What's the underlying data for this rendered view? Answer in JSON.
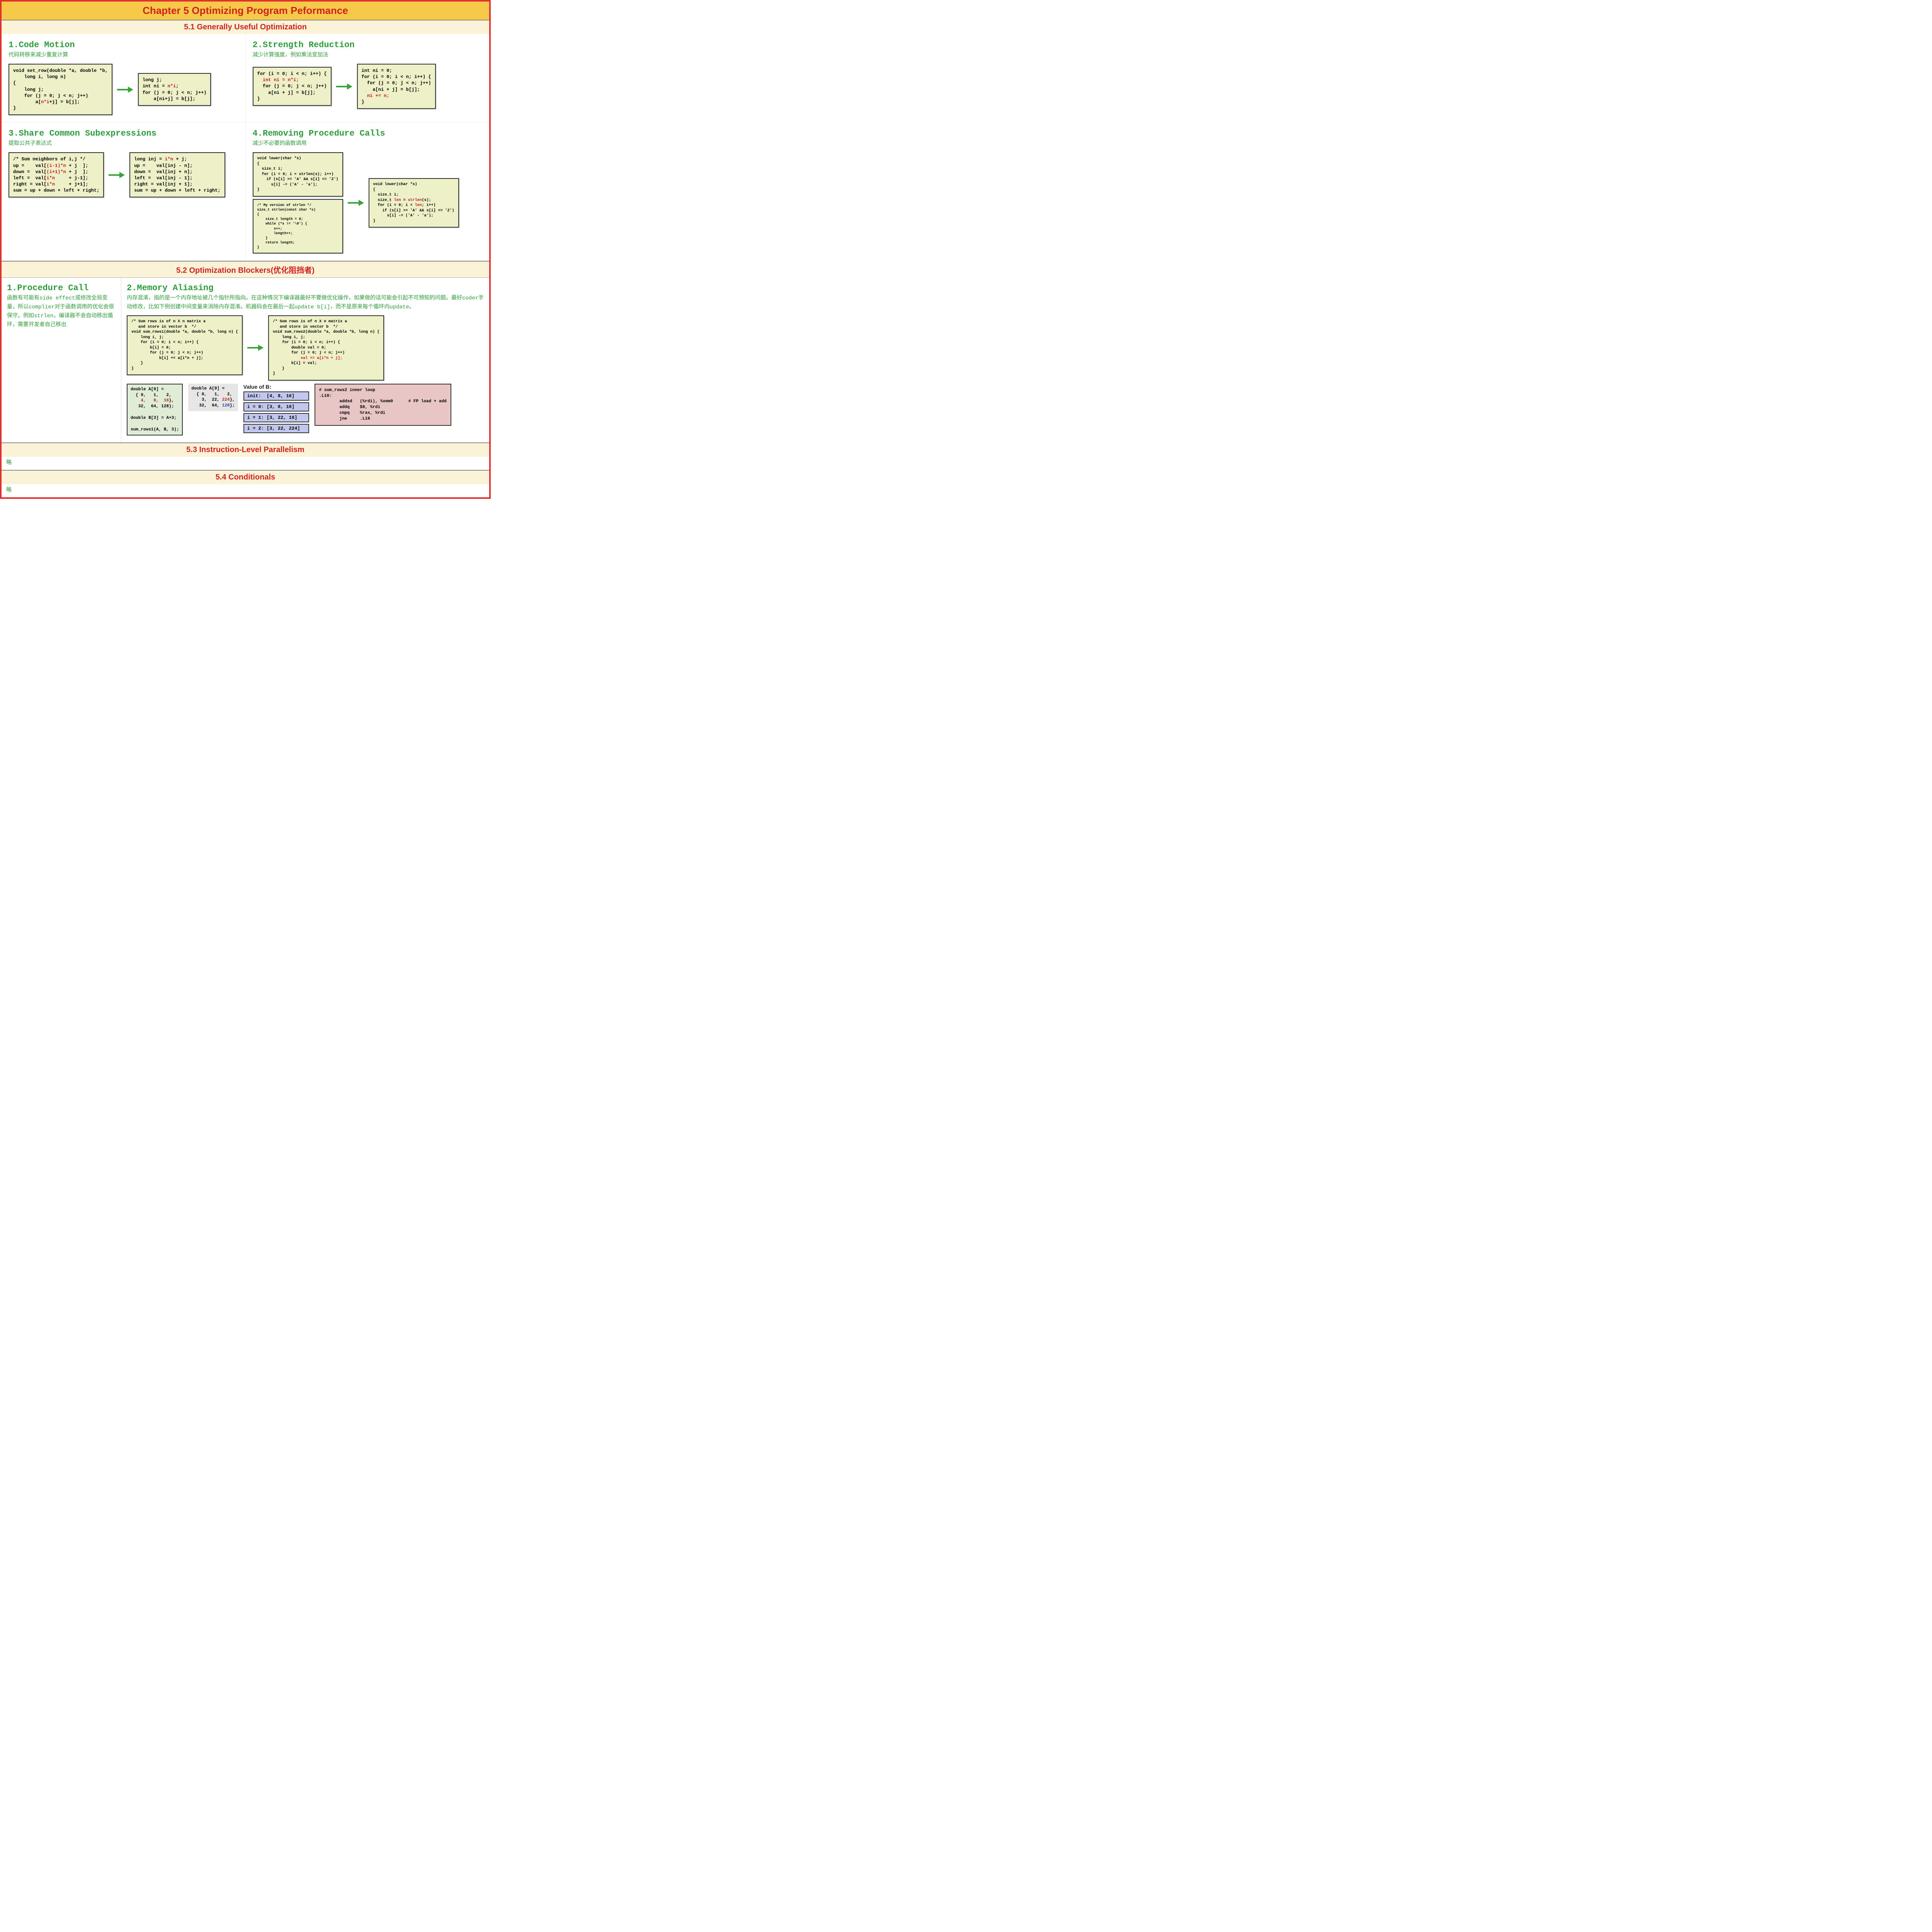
{
  "title": "Chapter 5 Optimizing Program Peformance",
  "s51": {
    "title": "5.1 Generally Useful Optimization",
    "p1": {
      "title": "1.Code Motion",
      "desc": "代码转移来减少重复计算",
      "code_a1": "void set_row(double *a, double *b,\n    long i, long n)\n{\n    long j;\n    for (j = 0; j < n; j++)\n        a[",
      "code_a_hl": "n*i",
      "code_a2": "+j] = b[j];\n}",
      "code_b1": "long j;\nint ni = ",
      "code_b_hl": "n*i",
      "code_b2": ";\nfor (j = 0; j < n; j++)\n    a[ni+j] = b[j];"
    },
    "p2": {
      "title": "2.Strength Reduction",
      "desc": "减少计算强度，例如乘法变加法",
      "code_a1": "for (i = 0; i < n; i++) {\n  ",
      "code_a_hl": "int ni = n*i;",
      "code_a2": "\n  for (j = 0; j < n; j++)\n    a[ni + j] = b[j];\n}",
      "code_b1": "int ni = 0;\nfor (i = 0; i < n; i++) {\n  for (j = 0; j < n; j++)\n    a[ni + j] = b[j];\n  ",
      "code_b_hl": "ni += n;",
      "code_b2": "\n}"
    },
    "p3": {
      "title": "3.Share Common Subexpressions",
      "desc": "提取公共子表达式",
      "code_a": "/* Sum neighbors of i,j */\nup =    val[<R>(i-1)*n</R> + j  ];\ndown =  val[<R>(i+1)*n</R> + j  ];\nleft =  val[<R>i*n</R>     + j-1];\nright = val[<R>i*n</R>     + j+1];\nsum = up + down + left + right;",
      "code_b": "long inj = <R>i*n</R> + j;\nup =    val[inj - n];\ndown =  val[inj + n];\nleft =  val[inj - 1];\nright = val[inj + 1];\nsum = up + down + left + right;"
    },
    "p4": {
      "title": "4.Removing Procedure Calls",
      "desc": "减少不必要的函数调用",
      "code_a": "void lower(char *s)\n{\n  size_t i;\n  for (i = 0; i < strlen(s); i++)\n    if (s[i] >= 'A' && s[i] <= 'Z')\n      s[i] -= ('A' - 'a');\n}",
      "code_b": "void lower(char *s)\n{\n  size_t i;\n  size_t <R>len</R> = <R>strlen</R>(s);\n  for (i = 0; i < <R>len</R>; i++)\n    if (s[i] >= 'A' && s[i] <= 'Z')\n      s[i] -= ('A' - 'a');\n}",
      "code_c": "/* My version of strlen */\nsize_t strlen(const char *s)\n{\n    size_t length = 0;\n    while (*s != '\\0') {\n        s++;\n        length++;\n    }\n    return length;\n}"
    }
  },
  "s52": {
    "title": "5.2 Optimization Blockers(优化阻挡者)",
    "b1": {
      "title": "1.Procedure Call",
      "text_parts": [
        "函数有可能有",
        "side effect",
        "或修改全局变量，所以",
        "complier",
        "对于函数调用的优化会很保守。例如",
        "strlen",
        "，编译器不会自动移出循环，需要开发者自己移出"
      ]
    },
    "b2": {
      "title": "2.Memory Aliasing",
      "text_parts": [
        "内存混淆，指的是一个内存地址被几个指针所指向。在这种情况下编译器最好不要做优化操作，如果做的话可能会引起不可预知的问题。最好",
        "coder",
        "手动修改，比如下例创建中间变量来消除内存混淆。机器码会在最后一起",
        "update b[i]",
        "，而不是原来每个循环内",
        "update",
        "。"
      ],
      "code_a": "/* Sum rows is of n X n matrix a\n   and store in vector b  */\nvoid sum_rows1(double *a, double *b, long n) {\n    long i, j;\n    for (i = 0; i < n; i++) {\n        b[i] = 0;\n        for (j = 0; j < n; j++)\n            b[i] += a[i*n + j];\n    }\n}",
      "code_b": "/* Sum rows is of n X n matrix a\n   and store in vector b  */\nvoid sum_rows2(double *a, double *b, long n) {\n    long i, j;\n    for (i = 0; i < n; i++) {\n        double val = 0;\n        for (j = 0; j < n; j++)\n            <R>val += a[i*n + j];</R>\n        b[i] = val;\n    }\n}",
      "green": "double A[9] =\n  { 0,   1,   2,\n    <R>4,   8,  16</R>},\n   32,  64, 128};\n\ndouble B[3] = A+3;\n\nsum_rows1(A, B, 3);",
      "grey": "double A[9] =\n  { 0,   1,   2,\n    3,  22, <R>224</R>},\n   32,  64, <B>128</B>};",
      "value_b_label": "Value of B:",
      "blue": [
        "init:  [4, 8, 16]",
        "i = 0: [3, 8, 16]",
        "i = 1: [3, 22, 16]",
        "i = 2: [3, 22, 224]"
      ],
      "pink": "# sum_rows2 inner loop\n.L10:\n        addsd   (%rdi), %xmm0      # FP load + add\n        addq    $8, %rdi\n        cmpq    %rax, %rdi\n        jne     .L10"
    }
  },
  "s53": {
    "title": "5.3 Instruction-Level Parallelism",
    "body": "略"
  },
  "s54": {
    "title": "5.4 Conditionals",
    "body": "略"
  }
}
